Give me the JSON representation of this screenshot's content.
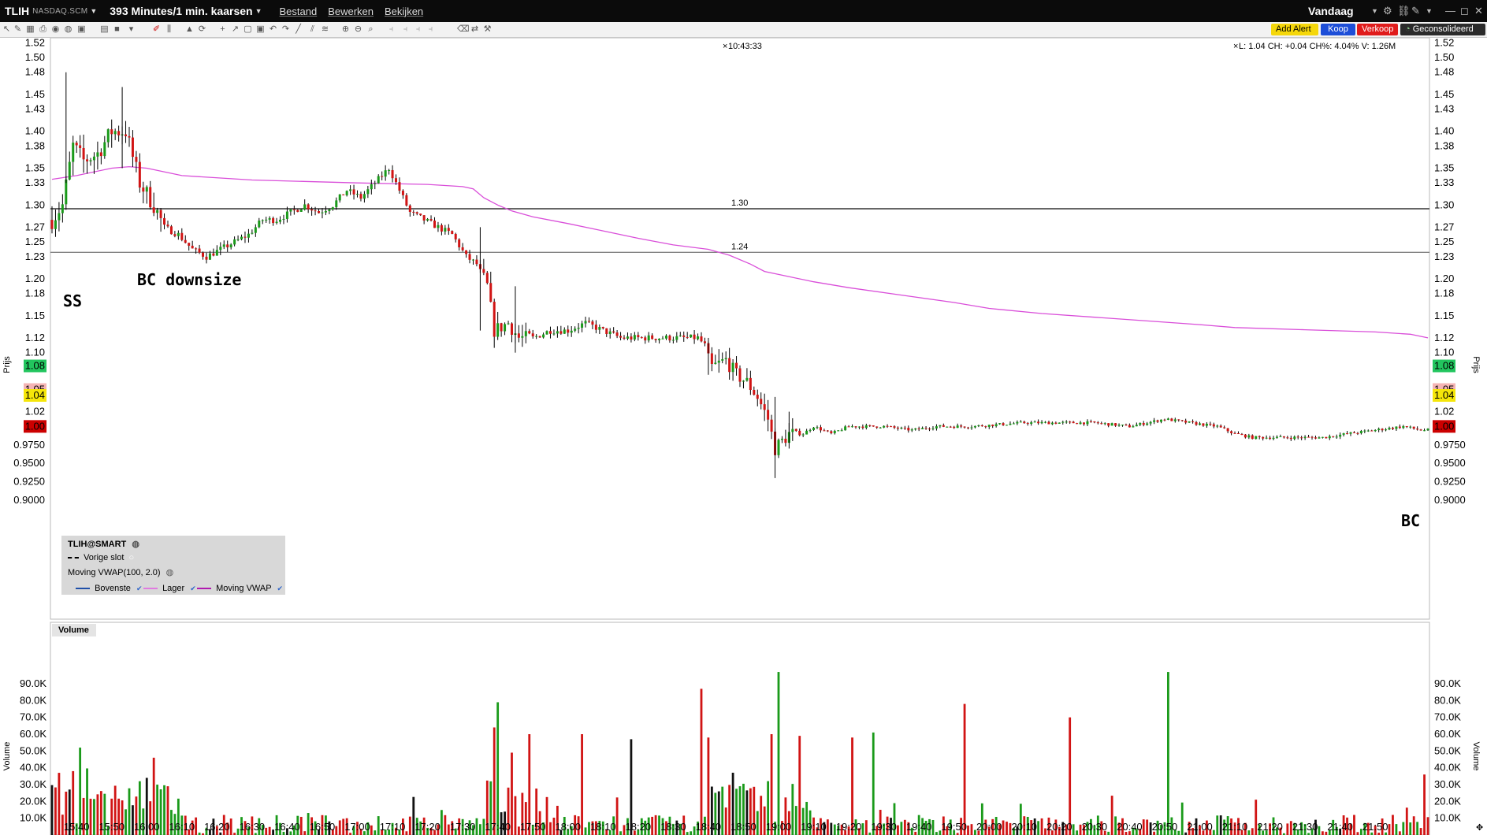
{
  "window": {
    "symbol": "TLIH",
    "exchange": "NASDAQ.SCM",
    "period": "393 Minutes/1 min. kaarsen",
    "menu": [
      "Bestand",
      "Bewerken",
      "Bekijken"
    ],
    "range": "Vandaag"
  },
  "toolbar": {
    "add_alert": "Add Alert",
    "buy": "Koop",
    "sell": "Verkoop",
    "consolidated": "Geconsolideerd"
  },
  "header": {
    "time": "10:43:33",
    "info": "L: 1.04 CH: +0.04 CH%: 4.04% V: 1.26M"
  },
  "price_axis_label": "Prijs",
  "volume_axis_label": "Volume",
  "volume_panel_title": "Volume",
  "annotations": {
    "ss": "SS",
    "bc_downsize": "BC downsize",
    "bc": "BC"
  },
  "hlines": [
    {
      "label": "1.30",
      "price": 1.295
    },
    {
      "label": "1.24",
      "price": 1.236
    }
  ],
  "price_markers": [
    {
      "label": "1.08",
      "price": 1.082,
      "color": "#22c55e"
    },
    {
      "label": "1.05",
      "price": 1.05,
      "color": "#f4b4b4"
    },
    {
      "label": "1.04",
      "price": 1.042,
      "color": "#f5e60a"
    },
    {
      "label": "1.00",
      "price": 1.0,
      "color": "#cc0000"
    }
  ],
  "legend": {
    "title": "TLIH@SMART",
    "prev_close": "Vorige slot",
    "indicator": "Moving VWAP(100, 2.0)",
    "items": [
      {
        "label": "Bovenste",
        "color": "#1f4fa8"
      },
      {
        "label": "Lager",
        "color": "#e07be0"
      },
      {
        "label": "Moving VWAP",
        "color": "#b01bb0"
      }
    ]
  },
  "chart_data": {
    "type": "candlestick",
    "price_axis": {
      "ticks": [
        "1.52",
        "1.50",
        "1.48",
        "1.45",
        "1.43",
        "1.40",
        "1.38",
        "1.35",
        "1.33",
        "1.30",
        "1.27",
        "1.25",
        "1.23",
        "1.20",
        "1.18",
        "1.15",
        "1.12",
        "1.10",
        "1.08",
        "1.05",
        "1.04",
        "1.02",
        "1.00",
        "0.9750",
        "0.9500",
        "0.9250",
        "0.9000"
      ],
      "ylim": [
        0.9,
        1.52
      ]
    },
    "time_axis": {
      "ticks": [
        "15:40",
        "15:50",
        "16:00",
        "16:10",
        "16:20",
        "16:30",
        "16:40",
        "16:50",
        "17:00",
        "17:10",
        "17:20",
        "17:30",
        "17:40",
        "17:50",
        "18:00",
        "18:10",
        "18:20",
        "18:30",
        "18:40",
        "18:50",
        "19:00",
        "19:10",
        "19:20",
        "19:30",
        "19:40",
        "19:50",
        "20:00",
        "20:10",
        "20:20",
        "20:30",
        "20:40",
        "20:50",
        "21:00",
        "21:10",
        "21:20",
        "21:30",
        "21:40",
        "21:50"
      ],
      "start": "15:33",
      "end": "22:05"
    },
    "price_path": [
      [
        "15:33",
        1.28
      ],
      [
        "15:36",
        1.3
      ],
      [
        "15:39",
        1.38
      ],
      [
        "15:42",
        1.36
      ],
      [
        "15:46",
        1.37
      ],
      [
        "15:50",
        1.4
      ],
      [
        "15:54",
        1.4
      ],
      [
        "15:58",
        1.33
      ],
      [
        "16:02",
        1.3
      ],
      [
        "16:05",
        1.27
      ],
      [
        "16:09",
        1.26
      ],
      [
        "16:13",
        1.24
      ],
      [
        "16:17",
        1.23
      ],
      [
        "16:21",
        1.24
      ],
      [
        "16:25",
        1.25
      ],
      [
        "16:29",
        1.26
      ],
      [
        "16:33",
        1.28
      ],
      [
        "16:37",
        1.28
      ],
      [
        "16:41",
        1.29
      ],
      [
        "16:45",
        1.3
      ],
      [
        "16:49",
        1.29
      ],
      [
        "16:53",
        1.3
      ],
      [
        "16:57",
        1.32
      ],
      [
        "17:01",
        1.31
      ],
      [
        "17:05",
        1.33
      ],
      [
        "17:09",
        1.35
      ],
      [
        "17:12",
        1.32
      ],
      [
        "17:15",
        1.29
      ],
      [
        "17:19",
        1.28
      ],
      [
        "17:23",
        1.27
      ],
      [
        "17:27",
        1.26
      ],
      [
        "17:31",
        1.23
      ],
      [
        "17:34",
        1.22
      ],
      [
        "17:37",
        1.19
      ],
      [
        "17:39",
        1.13
      ],
      [
        "17:43",
        1.14
      ],
      [
        "17:46",
        1.12
      ],
      [
        "17:50",
        1.12
      ],
      [
        "17:55",
        1.13
      ],
      [
        "18:00",
        1.13
      ],
      [
        "18:05",
        1.14
      ],
      [
        "18:10",
        1.13
      ],
      [
        "18:15",
        1.12
      ],
      [
        "18:20",
        1.12
      ],
      [
        "18:30",
        1.12
      ],
      [
        "18:37",
        1.12
      ],
      [
        "18:39",
        1.11
      ],
      [
        "18:41",
        1.08
      ],
      [
        "18:45",
        1.09
      ],
      [
        "18:48",
        1.07
      ],
      [
        "18:51",
        1.06
      ],
      [
        "18:54",
        1.04
      ],
      [
        "18:57",
        1.01
      ],
      [
        "18:59",
        0.97
      ],
      [
        "19:03",
        0.99
      ],
      [
        "19:07",
        0.99
      ],
      [
        "19:10",
        1.0
      ],
      [
        "19:15",
        0.99
      ],
      [
        "19:20",
        1.0
      ],
      [
        "19:30",
        1.0
      ],
      [
        "19:38",
        0.995
      ],
      [
        "19:45",
        1.0
      ],
      [
        "19:55",
        1.0
      ],
      [
        "20:10",
        1.005
      ],
      [
        "20:20",
        1.005
      ],
      [
        "20:30",
        1.005
      ],
      [
        "20:40",
        1.0
      ],
      [
        "20:50",
        1.01
      ],
      [
        "20:57",
        1.005
      ],
      [
        "21:05",
        1.0
      ],
      [
        "21:10",
        0.99
      ],
      [
        "21:15",
        0.985
      ],
      [
        "21:25",
        0.985
      ],
      [
        "21:35",
        0.985
      ],
      [
        "21:42",
        0.99
      ],
      [
        "21:50",
        0.995
      ],
      [
        "21:58",
        1.0
      ],
      [
        "22:03",
        0.995
      ]
    ],
    "vwap_path": [
      [
        "15:33",
        1.335
      ],
      [
        "15:40",
        1.34
      ],
      [
        "15:50",
        1.35
      ],
      [
        "15:55",
        1.352
      ],
      [
        "16:00",
        1.35
      ],
      [
        "16:10",
        1.34
      ],
      [
        "16:30",
        1.334
      ],
      [
        "17:00",
        1.33
      ],
      [
        "17:20",
        1.328
      ],
      [
        "17:30",
        1.325
      ],
      [
        "17:33",
        1.322
      ],
      [
        "17:36",
        1.31
      ],
      [
        "17:40",
        1.3
      ],
      [
        "17:44",
        1.292
      ],
      [
        "17:50",
        1.284
      ],
      [
        "18:00",
        1.275
      ],
      [
        "18:10",
        1.265
      ],
      [
        "18:20",
        1.255
      ],
      [
        "18:30",
        1.246
      ],
      [
        "18:40",
        1.24
      ],
      [
        "18:46",
        1.232
      ],
      [
        "18:52",
        1.22
      ],
      [
        "18:56",
        1.21
      ],
      [
        "19:02",
        1.204
      ],
      [
        "19:10",
        1.196
      ],
      [
        "19:20",
        1.188
      ],
      [
        "19:35",
        1.178
      ],
      [
        "19:50",
        1.168
      ],
      [
        "20:00",
        1.16
      ],
      [
        "20:15",
        1.153
      ],
      [
        "20:30",
        1.148
      ],
      [
        "20:45",
        1.143
      ],
      [
        "21:00",
        1.138
      ],
      [
        "21:10",
        1.134
      ],
      [
        "21:30",
        1.131
      ],
      [
        "21:50",
        1.128
      ],
      [
        "22:00",
        1.125
      ],
      [
        "22:05",
        1.12
      ]
    ],
    "volume_axis": {
      "ticks": [
        "90.0K",
        "80.0K",
        "70.0K",
        "60.0K",
        "50.0K",
        "40.0K",
        "30.0K",
        "20.0K",
        "10.0K"
      ],
      "ylim": [
        0,
        100000
      ]
    },
    "volume_spikes": [
      {
        "time": "15:35",
        "value": 37000,
        "color": "red"
      },
      {
        "time": "15:39",
        "value": 38000,
        "color": "red"
      },
      {
        "time": "15:41",
        "value": 52000,
        "color": "green"
      },
      {
        "time": "16:02",
        "value": 46000,
        "color": "red"
      },
      {
        "time": "16:00",
        "value": 34000,
        "color": "black"
      },
      {
        "time": "17:39",
        "value": 64000,
        "color": "red"
      },
      {
        "time": "17:40",
        "value": 79000,
        "color": "green"
      },
      {
        "time": "17:44",
        "value": 49000,
        "color": "red"
      },
      {
        "time": "17:49",
        "value": 60000,
        "color": "red"
      },
      {
        "time": "18:04",
        "value": 60000,
        "color": "red"
      },
      {
        "time": "18:18",
        "value": 57000,
        "color": "black"
      },
      {
        "time": "18:38",
        "value": 87000,
        "color": "red"
      },
      {
        "time": "18:40",
        "value": 58000,
        "color": "red"
      },
      {
        "time": "18:58",
        "value": 60000,
        "color": "red"
      },
      {
        "time": "19:00",
        "value": 97000,
        "color": "green"
      },
      {
        "time": "19:06",
        "value": 59000,
        "color": "red"
      },
      {
        "time": "19:21",
        "value": 58000,
        "color": "red"
      },
      {
        "time": "19:27",
        "value": 61000,
        "color": "green"
      },
      {
        "time": "19:53",
        "value": 78000,
        "color": "red"
      },
      {
        "time": "20:23",
        "value": 70000,
        "color": "red"
      },
      {
        "time": "20:51",
        "value": 97000,
        "color": "green"
      },
      {
        "time": "22:04",
        "value": 36000,
        "color": "red"
      }
    ]
  }
}
